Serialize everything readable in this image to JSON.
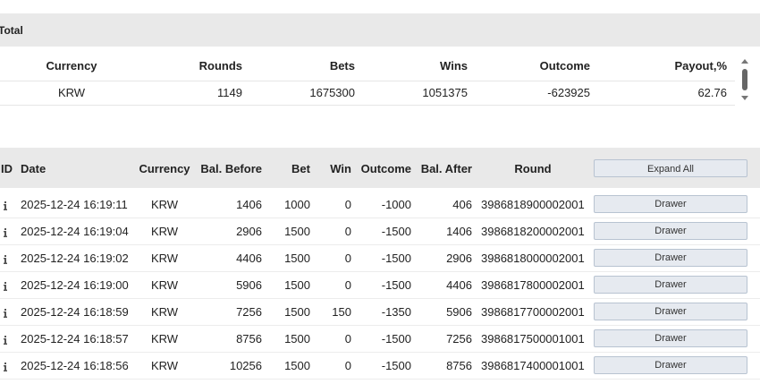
{
  "summary": {
    "title": "Total",
    "headers": {
      "currency": "Currency",
      "rounds": "Rounds",
      "bets": "Bets",
      "wins": "Wins",
      "outcome": "Outcome",
      "payout": "Payout,%"
    },
    "row": {
      "currency": "KRW",
      "rounds": "1149",
      "bets": "1675300",
      "wins": "1051375",
      "outcome": "-623925",
      "payout": "62.76"
    }
  },
  "details": {
    "headers": {
      "id": "ID",
      "date": "Date",
      "currency": "Currency",
      "bal_before": "Bal. Before",
      "bet": "Bet",
      "win": "Win",
      "outcome": "Outcome",
      "bal_after": "Bal. After",
      "round": "Round",
      "expand_all": "Expand All"
    },
    "rows": [
      {
        "date": "2025-12-24 16:19:11",
        "currency": "KRW",
        "bal_before": "1406",
        "bet": "1000",
        "win": "0",
        "outcome": "-1000",
        "bal_after": "406",
        "round": "3986818900002001",
        "action": "Drawer"
      },
      {
        "date": "2025-12-24 16:19:04",
        "currency": "KRW",
        "bal_before": "2906",
        "bet": "1500",
        "win": "0",
        "outcome": "-1500",
        "bal_after": "1406",
        "round": "3986818200002001",
        "action": "Drawer"
      },
      {
        "date": "2025-12-24 16:19:02",
        "currency": "KRW",
        "bal_before": "4406",
        "bet": "1500",
        "win": "0",
        "outcome": "-1500",
        "bal_after": "2906",
        "round": "3986818000002001",
        "action": "Drawer"
      },
      {
        "date": "2025-12-24 16:19:00",
        "currency": "KRW",
        "bal_before": "5906",
        "bet": "1500",
        "win": "0",
        "outcome": "-1500",
        "bal_after": "4406",
        "round": "3986817800002001",
        "action": "Drawer"
      },
      {
        "date": "2025-12-24 16:18:59",
        "currency": "KRW",
        "bal_before": "7256",
        "bet": "1500",
        "win": "150",
        "outcome": "-1350",
        "bal_after": "5906",
        "round": "3986817700002001",
        "action": "Drawer"
      },
      {
        "date": "2025-12-24 16:18:57",
        "currency": "KRW",
        "bal_before": "8756",
        "bet": "1500",
        "win": "0",
        "outcome": "-1500",
        "bal_after": "7256",
        "round": "3986817500001001",
        "action": "Drawer"
      },
      {
        "date": "2025-12-24 16:18:56",
        "currency": "KRW",
        "bal_before": "10256",
        "bet": "1500",
        "win": "0",
        "outcome": "-1500",
        "bal_after": "8756",
        "round": "3986817400001001",
        "action": "Drawer"
      }
    ]
  },
  "icons": {
    "row_info": "info-icon",
    "scroll_up": "scroll-up-arrow-icon",
    "scroll_down": "scroll-down-arrow-icon"
  }
}
